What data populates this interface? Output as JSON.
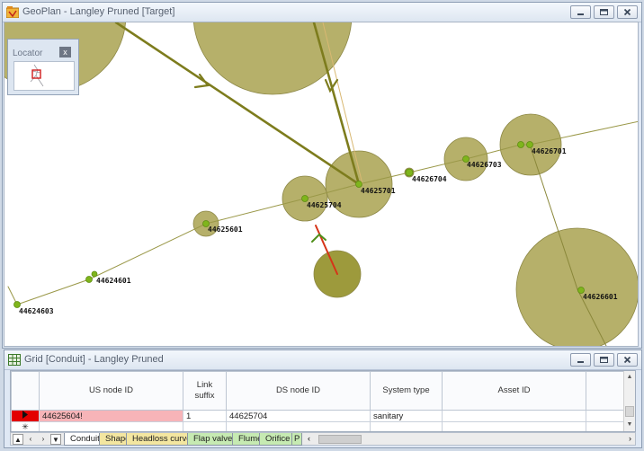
{
  "geoplan": {
    "title": "GeoPlan - Langley Pruned [Target]",
    "locator_title": "Locator",
    "locator_close": "x",
    "node_labels": [
      "44625701",
      "44626704",
      "44626703",
      "44626701",
      "44625704",
      "44625601",
      "44624601",
      "44624603",
      "44626601"
    ]
  },
  "grid": {
    "title": "Grid [Conduit] - Langley Pruned",
    "columns": [
      "US node ID",
      "Link suffix",
      "DS node ID",
      "System type",
      "Asset ID"
    ],
    "rows": [
      {
        "us_node_id": "44625604!",
        "link_suffix": "1",
        "ds_node_id": "44625704",
        "system_type": "sanitary",
        "asset_id": ""
      }
    ],
    "new_row_marker": "✳",
    "tabs": [
      "Conduit",
      "Shape",
      "Headloss curve",
      "Flap valve",
      "Flume",
      "Orifice",
      "P"
    ]
  },
  "colors": {
    "node_circle": "#b6b06a",
    "selected_circle": "#9d9a3c",
    "link": "#7d7c1d",
    "selected_link": "#d63418",
    "node": "#7fb51c",
    "row_error": "#f7b4b8",
    "row_indicator": "#e30000"
  },
  "icons": [
    "geoplan-app-icon",
    "grid-app-icon",
    "minimize-icon",
    "restore-icon",
    "close-icon"
  ]
}
